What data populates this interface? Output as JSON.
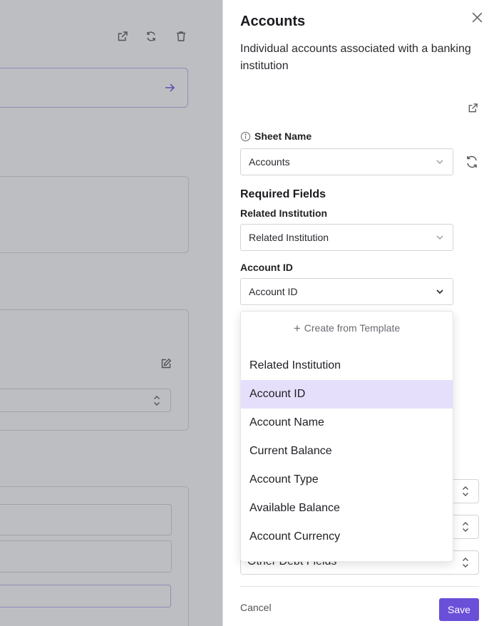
{
  "drawer": {
    "title": "Accounts",
    "description": "Individual accounts associated with a banking institution",
    "sheet_name_label": "Sheet Name",
    "sheet_name_value": "Accounts",
    "required_fields_heading": "Required Fields",
    "fields": [
      {
        "label": "Related Institution",
        "value": "Related Institution"
      },
      {
        "label": "Account ID",
        "value": "Account ID"
      }
    ],
    "dropdown": {
      "create_label": "Create from Template",
      "options": [
        "Related Institution",
        "Account ID",
        "Account Name",
        "Current Balance",
        "Account Type",
        "Available Balance",
        "Account Currency"
      ],
      "selected": "Account ID"
    },
    "lower_select_value": "Other Debt Fields",
    "cancel_label": "Cancel",
    "save_label": "Save"
  },
  "colors": {
    "accent": "#6a4fd8",
    "selected_option": "#e5dffb",
    "overlay": "#484a56"
  },
  "icons": {
    "close": "close-icon",
    "external_link": "external-link-icon",
    "info": "info-icon",
    "refresh": "refresh-icon",
    "chevron": "chevron-down-icon",
    "plus": "plus-icon"
  }
}
